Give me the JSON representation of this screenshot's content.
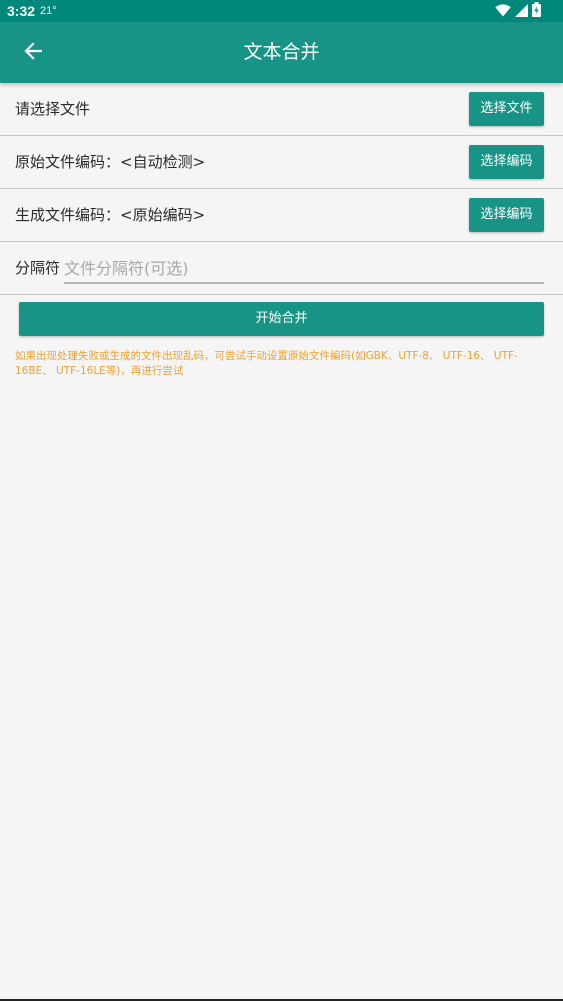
{
  "status_bar": {
    "time": "3:32",
    "temperature": "21°",
    "icons": [
      "wifi-icon",
      "cell-signal-icon",
      "battery-icon"
    ]
  },
  "app_bar": {
    "title": "文本合并",
    "back_icon": "arrow-left-icon"
  },
  "rows": {
    "file": {
      "label": "请选择文件",
      "button": "选择文件"
    },
    "source_encoding": {
      "label": "原始文件编码：<自动检测>",
      "button": "选择编码"
    },
    "output_encoding": {
      "label": "生成文件编码：<原始编码>",
      "button": "选择编码"
    }
  },
  "separator": {
    "label": "分隔符",
    "value": "",
    "placeholder": "文件分隔符(可选)"
  },
  "start_button": "开始合并",
  "hint": "如果出现处理失败或生成的文件出现乱码，可尝试手动设置原始文件编码(如GBK、UTF-8、 UTF-16、 UTF-16BE、 UTF-16LE等)，再进行尝试",
  "colors": {
    "status_bar": "#00897b",
    "primary": "#179486",
    "hint_text": "#f0a030",
    "background": "#f5f5f5"
  }
}
